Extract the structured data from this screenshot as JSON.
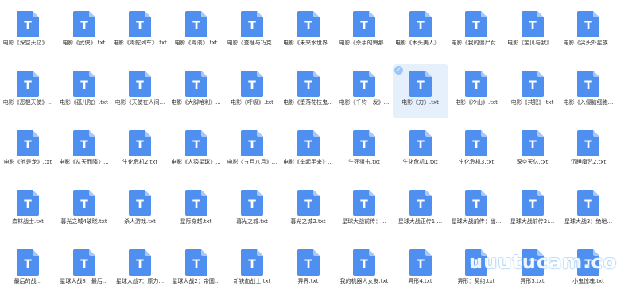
{
  "files": [
    "电影《深空天亿》...",
    "电影《武侠》.txt",
    "电影《毒蛇列车》.txt",
    "电影《毒液》.txt",
    "电影《查理与巧克...",
    "电影《未来水世界...",
    "电影《杀手的悔那...",
    "电影《木头美人》...",
    "电影《我的僵尸女...",
    "电影《宝贝与我》...",
    "电影《尖头外星族...",
    "电影《恶棍天使》...",
    "电影《孤儿院》.txt",
    "电影《天使在人间...",
    "电影《大脚哈利》...",
    "电影《呼吸》.txt",
    "电影《堕落花枝鬼...",
    "电影《千钧一发》...",
    "电影《刀》.txt",
    "电影《冷山》.txt",
    "电影《共犯》.txt",
    "电影《入侵脑细胞...",
    "电影《他是龙》.txt",
    "电影《从天而降》...",
    "生化危机2.txt",
    "电影《人猿星球》...",
    "电影《五月八月》...",
    "电影《举起手来》...",
    "生死狙击.txt",
    "生化危机1.txt",
    "生化危机3.txt",
    "深空天亿.txt",
    "沉睡魔咒2.txt",
    "森林战士.txt",
    "暮光之城4破晓.txt",
    "杀人游戏.txt",
    "星际穿越.txt",
    "暮光之城.txt",
    "暮光之城2.txt",
    "星球大战前传：...",
    "星球大战正传1:...",
    "星球大战前传：幽...",
    "星球大战前传2:...",
    "星球大战3：绝地...",
    "最后的战...",
    "星球大战8：最后...",
    "星球大战7：原力...",
    "星球大战2：帝国...",
    "新铁血战士.txt",
    "异界.txt",
    "我的机器人女友.txt",
    "异形4.txt",
    "异形：契约.txt",
    "异形3.txt",
    "小鬼惊魂.txt"
  ],
  "selected_file": "电影《刀》.txt",
  "watermark": "uuutucam.co",
  "colors": {
    "icon_blue": "#4f8ff0",
    "icon_fold": "#a9c8f7",
    "selected_bg": "#e6f0fd",
    "text": "#333333"
  }
}
